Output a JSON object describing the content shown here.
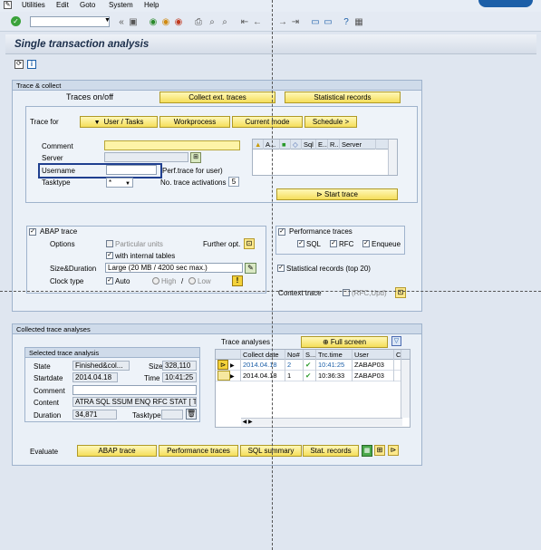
{
  "menu": [
    "Utilities",
    "Edit",
    "Goto",
    "System",
    "Help"
  ],
  "title": "Single transaction analysis",
  "trace_collect": {
    "header": "Trace & collect",
    "traces_onoff": "Traces on/off",
    "collect_ext_traces": "Collect ext. traces",
    "statistical_records": "Statistical records",
    "trace_for": "Trace for",
    "tab_user_tasks": "User / Tasks",
    "tab_workprocess": "Workprocess",
    "tab_current_mode": "Current mode",
    "tab_schedule": "Schedule >",
    "comment_label": "Comment",
    "server_label": "Server",
    "username_label": "Username",
    "tasktype_label": "Tasktype",
    "tasktype_value": "*",
    "perf_trace_for_user": "Perf.trace for user)",
    "no_trace_activations_label": "No. trace activations",
    "no_trace_activations_value": "5",
    "server_grid_headers": [
      "A...",
      "Sql",
      "E...",
      "R...",
      "Server"
    ],
    "start_trace": "Start trace"
  },
  "abap_trace": {
    "label": "ABAP trace",
    "options_label": "Options",
    "particular_units": "Particular units",
    "with_internal_tables": "with internal tables",
    "further_opt": "Further opt.",
    "size_duration_label": "Size&Duration",
    "size_duration_value": "Large (20 MB / 4200 sec max.)",
    "clock_type_label": "Clock type",
    "clock_auto": "Auto",
    "clock_high": "High",
    "clock_low": "Low"
  },
  "performance_traces": {
    "label": "Performance traces",
    "sql": "SQL",
    "rfc": "RFC",
    "enqueue": "Enqueue",
    "statistical_records_top": "Statistical records (top 20)",
    "context_trace": "Context trace",
    "rfc_upd": "(RFC,Upd)"
  },
  "collected": {
    "header": "Collected trace analyses",
    "selected_header": "Selected trace analysis",
    "state_label": "State",
    "state_value": "Finished&col...",
    "size_label": "Size",
    "size_value": "328,110",
    "startdate_label": "Startdate",
    "startdate_value": "2014.04.18",
    "time_label": "Time",
    "time_value": "10:41:25",
    "comment_label": "Comment",
    "content_label": "Content",
    "content_value": "ATRA SQL SSUM ENQ RFC STAT [ Tr...",
    "duration_label": "Duration",
    "duration_value": "34,871",
    "tasktype_label": "Tasktype",
    "trace_analyses": "Trace analyses",
    "full_screen": "Full screen",
    "table_headers": [
      "Collect date",
      "No#",
      "S...",
      "Trc.time",
      "User",
      "C"
    ],
    "rows": [
      {
        "date": "2014.04.18",
        "no": "2",
        "time": "10:41:25",
        "user": "ZABAP03"
      },
      {
        "date": "2014.04.18",
        "no": "1",
        "time": "10:36:33",
        "user": "ZABAP03"
      }
    ]
  },
  "evaluate": {
    "label": "Evaluate",
    "abap_trace": "ABAP trace",
    "performance_traces": "Performance traces",
    "sql_summary": "SQL summary",
    "stat_records": "Stat. records"
  },
  "colors": {
    "highlight_box": "#1f3f8f",
    "button_yellow": "#f5de5a",
    "group_bg": "#eaf0f7"
  }
}
